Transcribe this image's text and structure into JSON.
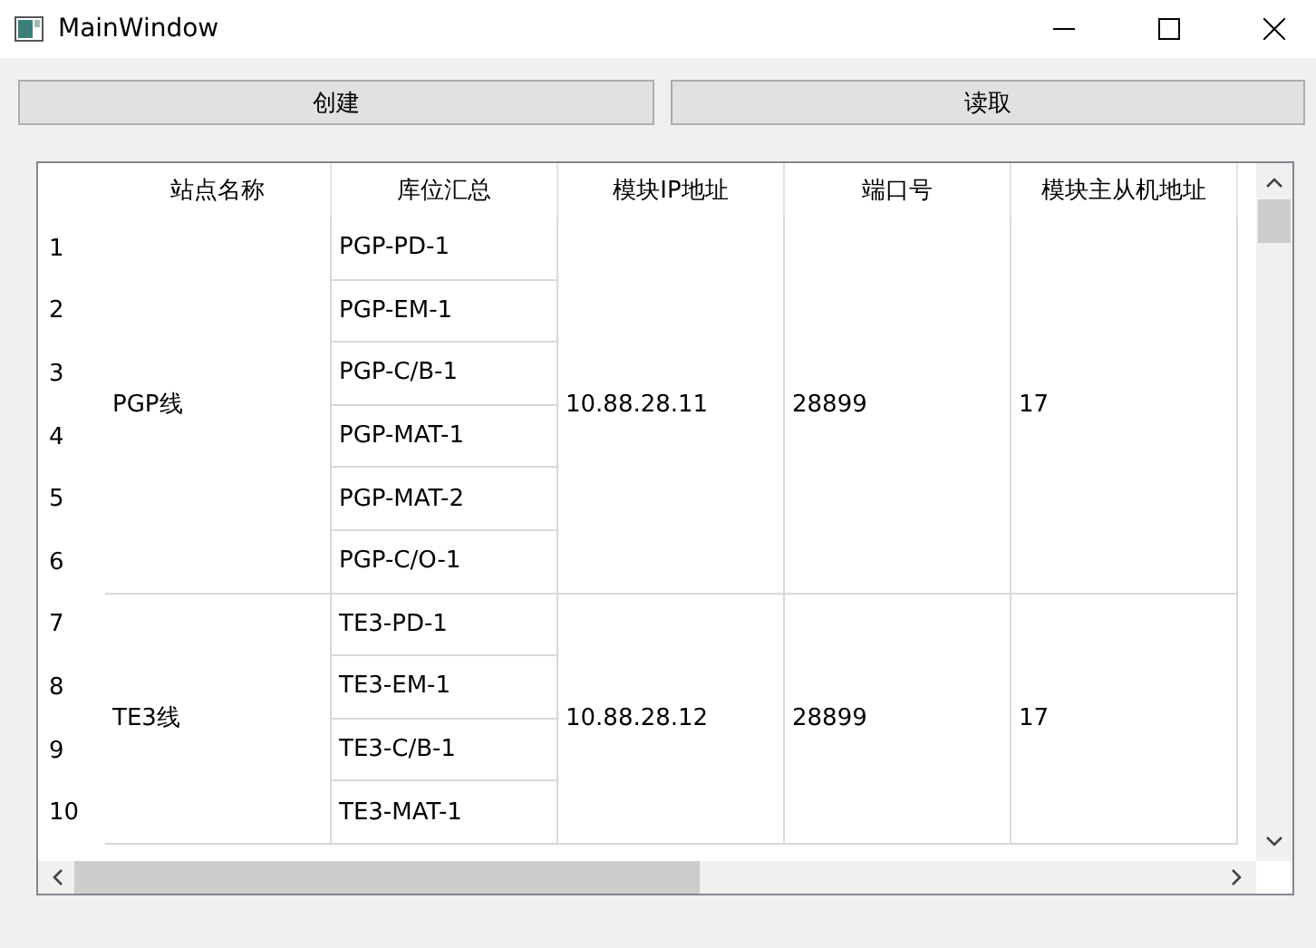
{
  "window": {
    "title": "MainWindow"
  },
  "buttons": [
    "创建",
    "读取"
  ],
  "table": {
    "columns": [
      "站点名称",
      "库位汇总",
      "模块IP地址",
      "端口号",
      "模块主从机地址"
    ],
    "row_numbers": [
      "1",
      "2",
      "3",
      "4",
      "5",
      "6",
      "7",
      "8",
      "9",
      "10"
    ],
    "groups": [
      {
        "station": "PGP线",
        "slots": [
          "PGP-PD-1",
          "PGP-EM-1",
          "PGP-C/B-1",
          "PGP-MAT-1",
          "PGP-MAT-2",
          "PGP-C/O-1"
        ],
        "ip": "10.88.28.11",
        "port": "28899",
        "address": "17"
      },
      {
        "station": "TE3线",
        "slots": [
          "TE3-PD-1",
          "TE3-EM-1",
          "TE3-C/B-1",
          "TE3-MAT-1"
        ],
        "ip": "10.88.28.12",
        "port": "28899",
        "address": "17"
      }
    ]
  }
}
